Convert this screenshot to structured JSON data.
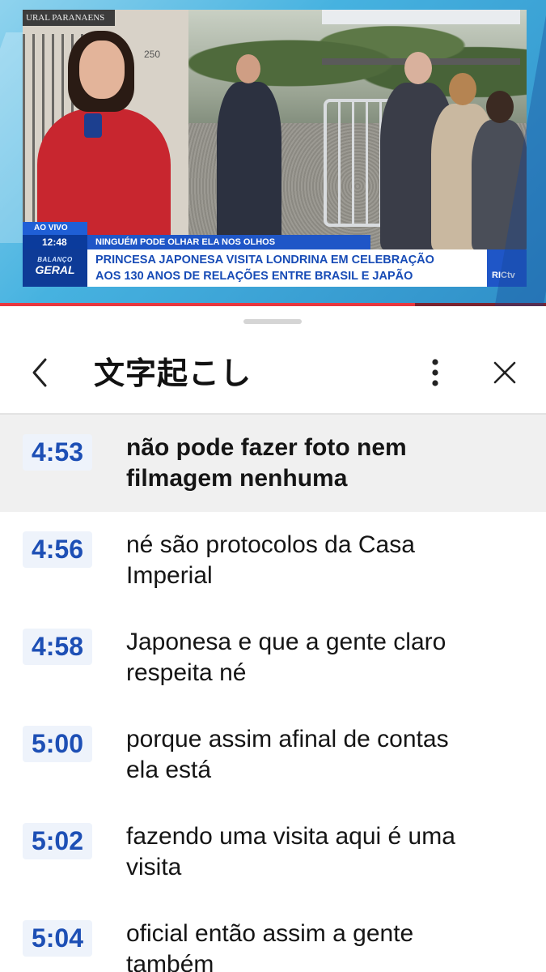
{
  "video": {
    "scene_sign": "URAL PARANAENS",
    "house_number": "250",
    "live_label": "AO VIVO",
    "clock": "12:48",
    "tagline": "NINGUÉM PODE OLHAR ELA NOS OLHOS",
    "program_line1": "BALANÇO",
    "program_line2": "GERAL",
    "headline_line1": "PRINCESA JAPONESA VISITA LONDRINA EM CELEBRAÇÃO",
    "headline_line2": "AOS 130 ANOS DE RELAÇÕES ENTRE BRASIL E JAPÃO",
    "channel_logo": "RICtv",
    "progress_fraction": 0.76,
    "accent_red": "#e8383f",
    "accent_blue": "#1f56c7"
  },
  "sheet": {
    "title": "文字起こし",
    "back_icon": "chevron-left-icon",
    "more_icon": "vertical-dots-icon",
    "close_icon": "close-icon"
  },
  "transcript": [
    {
      "time": "4:53",
      "line1": "não pode fazer foto nem",
      "line2": "filmagem nenhuma",
      "active": true
    },
    {
      "time": "4:56",
      "line1": "né são protocolos da Casa",
      "line2": "Imperial",
      "active": false
    },
    {
      "time": "4:58",
      "line1": "Japonesa e que a gente claro",
      "line2": "respeita né",
      "active": false
    },
    {
      "time": "5:00",
      "line1": "porque assim afinal de contas",
      "line2": "ela está",
      "active": false
    },
    {
      "time": "5:02",
      "line1": "fazendo uma visita aqui é uma",
      "line2": "visita",
      "active": false
    },
    {
      "time": "5:04",
      "line1": "oficial então assim a gente",
      "line2": "também",
      "active": false
    }
  ]
}
